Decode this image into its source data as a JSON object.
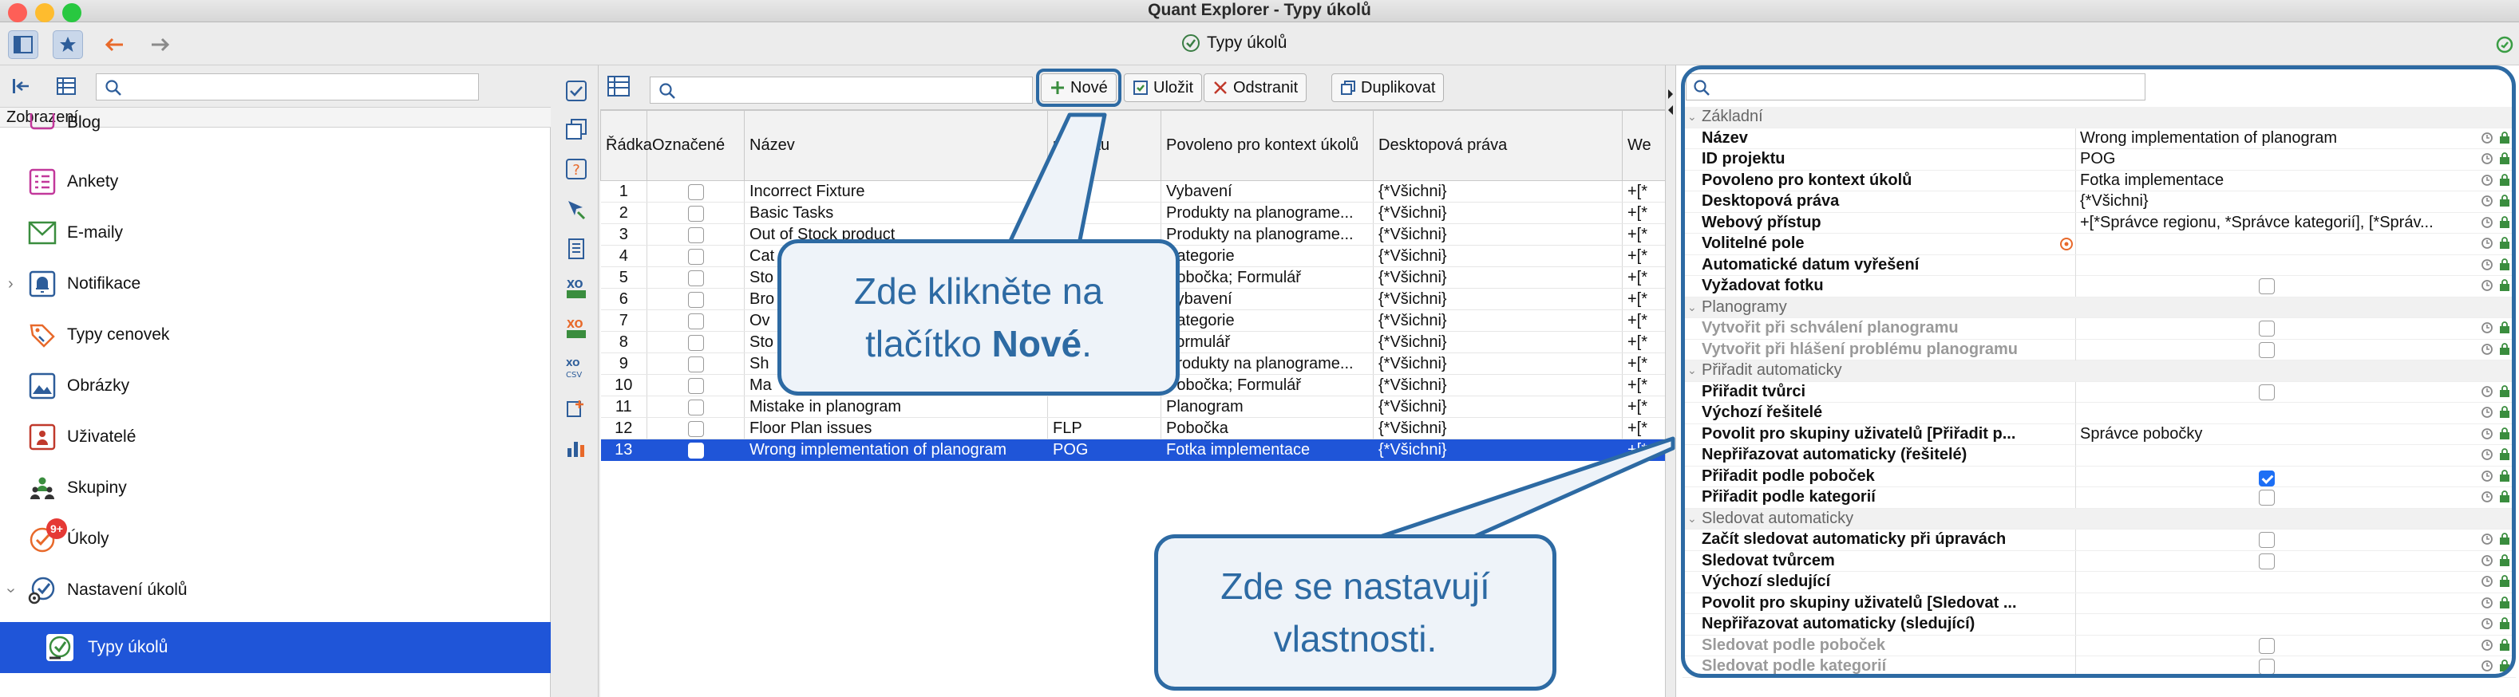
{
  "window": {
    "title": "Quant Explorer - Typy úkolů"
  },
  "toolbar": {
    "center_title": "Typy úkolů"
  },
  "sidebar": {
    "search_placeholder": "",
    "section_label": "Zobrazení",
    "items": [
      {
        "label": "Blog",
        "icon": "blog-icon"
      },
      {
        "label": "Ankety",
        "icon": "poll-icon"
      },
      {
        "label": "E-maily",
        "icon": "email-icon"
      },
      {
        "label": "Notifikace",
        "icon": "bell-icon",
        "expandable": true
      },
      {
        "label": "Typy cenovek",
        "icon": "price-tag-icon"
      },
      {
        "label": "Obrázky",
        "icon": "image-icon"
      },
      {
        "label": "Uživatelé",
        "icon": "user-icon"
      },
      {
        "label": "Skupiny",
        "icon": "group-icon"
      },
      {
        "label": "Úkoly",
        "icon": "task-icon",
        "badge": "9+"
      },
      {
        "label": "Nastavení úkolů",
        "icon": "task-settings-icon",
        "expanded": true
      },
      {
        "label": "Typy úkolů",
        "icon": "task-type-icon",
        "selected": true
      }
    ]
  },
  "main": {
    "search_placeholder": "",
    "buttons": {
      "new": "Nové",
      "save": "Uložit",
      "delete": "Odstranit",
      "duplicate": "Duplikovat"
    },
    "columns": [
      "Řádka",
      "Označené",
      "Název",
      "projektu",
      "Povoleno pro kontext úkolů",
      "Desktopová práva",
      "We"
    ],
    "rows": [
      {
        "n": "1",
        "name": "Incorrect Fixture",
        "proj": "",
        "ctx": "Vybavení",
        "rights": "{*Všichni}",
        "web": "+[*"
      },
      {
        "n": "2",
        "name": "Basic Tasks",
        "proj": "",
        "ctx": "Produkty na planograme...",
        "rights": "{*Všichni}",
        "web": "+[*"
      },
      {
        "n": "3",
        "name": "Out of Stock product",
        "proj": "",
        "ctx": "Produkty na planograme...",
        "rights": "{*Všichni}",
        "web": "+[*"
      },
      {
        "n": "4",
        "name": "Cat",
        "proj": "",
        "ctx": "Kategorie",
        "rights": "{*Všichni}",
        "web": "+[*"
      },
      {
        "n": "5",
        "name": "Sto",
        "proj": "",
        "ctx": "Pobočka; Formulář",
        "rights": "{*Všichni}",
        "web": "+[*"
      },
      {
        "n": "6",
        "name": "Bro",
        "proj": "",
        "ctx": "Vybavení",
        "rights": "{*Všichni}",
        "web": "+[*"
      },
      {
        "n": "7",
        "name": "Ov",
        "proj": "",
        "ctx": "Kategorie",
        "rights": "{*Všichni}",
        "web": "+[*"
      },
      {
        "n": "8",
        "name": "Sto",
        "proj": "",
        "ctx": "Formulář",
        "rights": "{*Všichni}",
        "web": "+[*"
      },
      {
        "n": "9",
        "name": "Sh",
        "proj": "",
        "ctx": "Produkty na planograme...",
        "rights": "{*Všichni}",
        "web": "+[*"
      },
      {
        "n": "10",
        "name": "Ma",
        "proj": "",
        "ctx": "Pobočka; Formulář",
        "rights": "{*Všichni}",
        "web": "+[*"
      },
      {
        "n": "11",
        "name": "Mistake in planogram",
        "proj": "",
        "ctx": "Planogram",
        "rights": "{*Všichni}",
        "web": "+[*"
      },
      {
        "n": "12",
        "name": "Floor Plan issues",
        "proj": "FLP",
        "ctx": "Pobočka",
        "rights": "{*Všichni}",
        "web": "+[*"
      },
      {
        "n": "13",
        "name": "Wrong implementation of planogram",
        "proj": "POG",
        "ctx": "Fotka implementace",
        "rights": "{*Všichni}",
        "web": "+[*",
        "selected": true
      }
    ]
  },
  "props": {
    "search_placeholder": "",
    "rows": [
      {
        "type": "section",
        "label": "Základní"
      },
      {
        "name": "Název",
        "value": "Wrong implementation of planogram"
      },
      {
        "name": "ID projektu",
        "value": "POG"
      },
      {
        "name": "Povoleno pro kontext úkolů",
        "value": "Fotka implementace"
      },
      {
        "name": "Desktopová práva",
        "value": "{*Všichni}"
      },
      {
        "name": "Webový přístup",
        "value": "+[*Správce regionu, *Správce kategorií], [*Správ..."
      },
      {
        "name": "Volitelné pole",
        "value": "",
        "optional": true
      },
      {
        "name": "Automatické datum vyřešení",
        "value": ""
      },
      {
        "name": "Vyžadovat fotku",
        "value": "",
        "check": "off"
      },
      {
        "type": "section",
        "label": "Planogramy"
      },
      {
        "name": "Vytvořit při schválení planogramu",
        "value": "",
        "check": "off",
        "disabled": true
      },
      {
        "name": "Vytvořit při hlášení problému planogramu",
        "value": "",
        "check": "off",
        "disabled": true
      },
      {
        "type": "section",
        "label": "Přiřadit automaticky"
      },
      {
        "name": "Přiřadit tvůrci",
        "value": "",
        "check": "off"
      },
      {
        "name": "Výchozí řešitelé",
        "value": ""
      },
      {
        "name": "Povolit pro skupiny uživatelů [Přiřadit p...",
        "value": "Správce pobočky"
      },
      {
        "name": "Nepřiřazovat automaticky (řešitelé)",
        "value": ""
      },
      {
        "name": "Přiřadit podle poboček",
        "value": "",
        "check": "on"
      },
      {
        "name": "Přiřadit podle kategorií",
        "value": "",
        "check": "off"
      },
      {
        "type": "section",
        "label": "Sledovat automaticky"
      },
      {
        "name": "Začít sledovat automaticky při úpravách",
        "value": "",
        "check": "off"
      },
      {
        "name": "Sledovat tvůrcem",
        "value": "",
        "check": "off"
      },
      {
        "name": "Výchozí sledující",
        "value": ""
      },
      {
        "name": "Povolit pro skupiny uživatelů [Sledovat ...",
        "value": ""
      },
      {
        "name": "Nepřiřazovat automaticky (sledující)",
        "value": ""
      },
      {
        "name": "Sledovat podle poboček",
        "value": "",
        "check": "off",
        "disabled": true
      },
      {
        "name": "Sledovat podle kategorií",
        "value": "",
        "check": "off",
        "disabled": true
      }
    ]
  },
  "callouts": {
    "new_line1": "Zde klikněte na",
    "new_line2_pre": "tlačítko ",
    "new_line2_bold": "Nové",
    "new_line2_post": ".",
    "props_line1": "Zde se nastavují",
    "props_line2": "vlastnosti."
  },
  "colors": {
    "accent": "#2d6aa3",
    "selection": "#1f55d8",
    "callout_bg": "#eef3f9"
  }
}
